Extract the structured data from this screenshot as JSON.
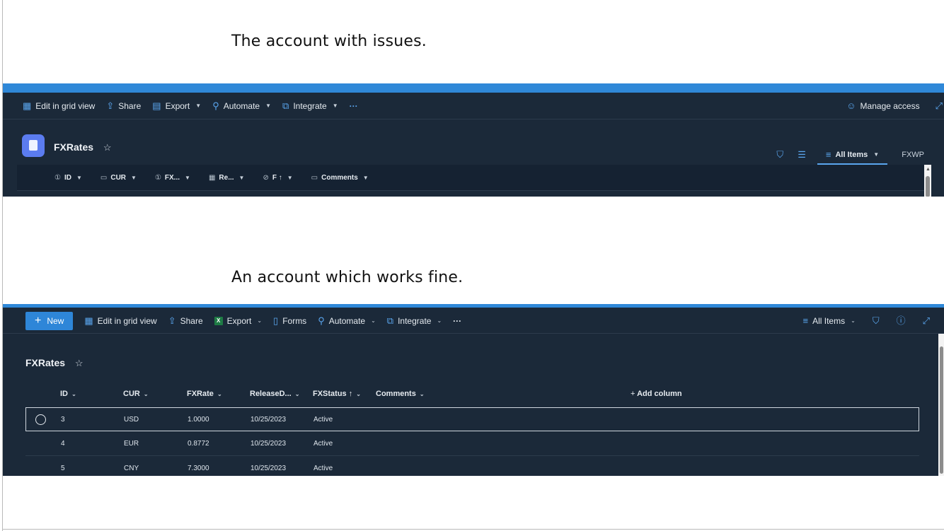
{
  "captions": {
    "issue": "The account with issues.",
    "fine": "An account which works fine."
  },
  "colors": {
    "accent": "#2f88d8",
    "panel_bg": "#1b2939",
    "icon_blue": "#5aa6ef"
  },
  "panel1": {
    "commands": {
      "edit_grid": "Edit in grid view",
      "share": "Share",
      "export": "Export",
      "automate": "Automate",
      "integrate": "Integrate",
      "more": "···",
      "manage_access": "Manage access"
    },
    "list_title": "FXRates",
    "view": {
      "all_items": "All Items",
      "fxwp": "FXWP"
    },
    "columns": {
      "id": "ID",
      "cur": "CUR",
      "fx": "FX...",
      "re": "Re...",
      "f": "F ↑",
      "comments": "Comments"
    }
  },
  "panel2": {
    "commands": {
      "new": "New",
      "edit_grid": "Edit in grid view",
      "share": "Share",
      "export": "Export",
      "excel_glyph": "X",
      "forms": "Forms",
      "automate": "Automate",
      "integrate": "Integrate",
      "more": "···",
      "all_items": "All Items"
    },
    "list_title": "FXRates",
    "columns": {
      "id": "ID",
      "cur": "CUR",
      "fxrate": "FXRate",
      "release": "ReleaseD...",
      "fxstatus": "FXStatus ↑",
      "comments": "Comments",
      "add_column": "Add column"
    },
    "rows": [
      {
        "id": "3",
        "cur": "USD",
        "fxrate": "1.0000",
        "release": "10/25/2023",
        "status": "Active"
      },
      {
        "id": "4",
        "cur": "EUR",
        "fxrate": "0.8772",
        "release": "10/25/2023",
        "status": "Active"
      },
      {
        "id": "5",
        "cur": "CNY",
        "fxrate": "7.3000",
        "release": "10/25/2023",
        "status": "Active"
      }
    ]
  }
}
